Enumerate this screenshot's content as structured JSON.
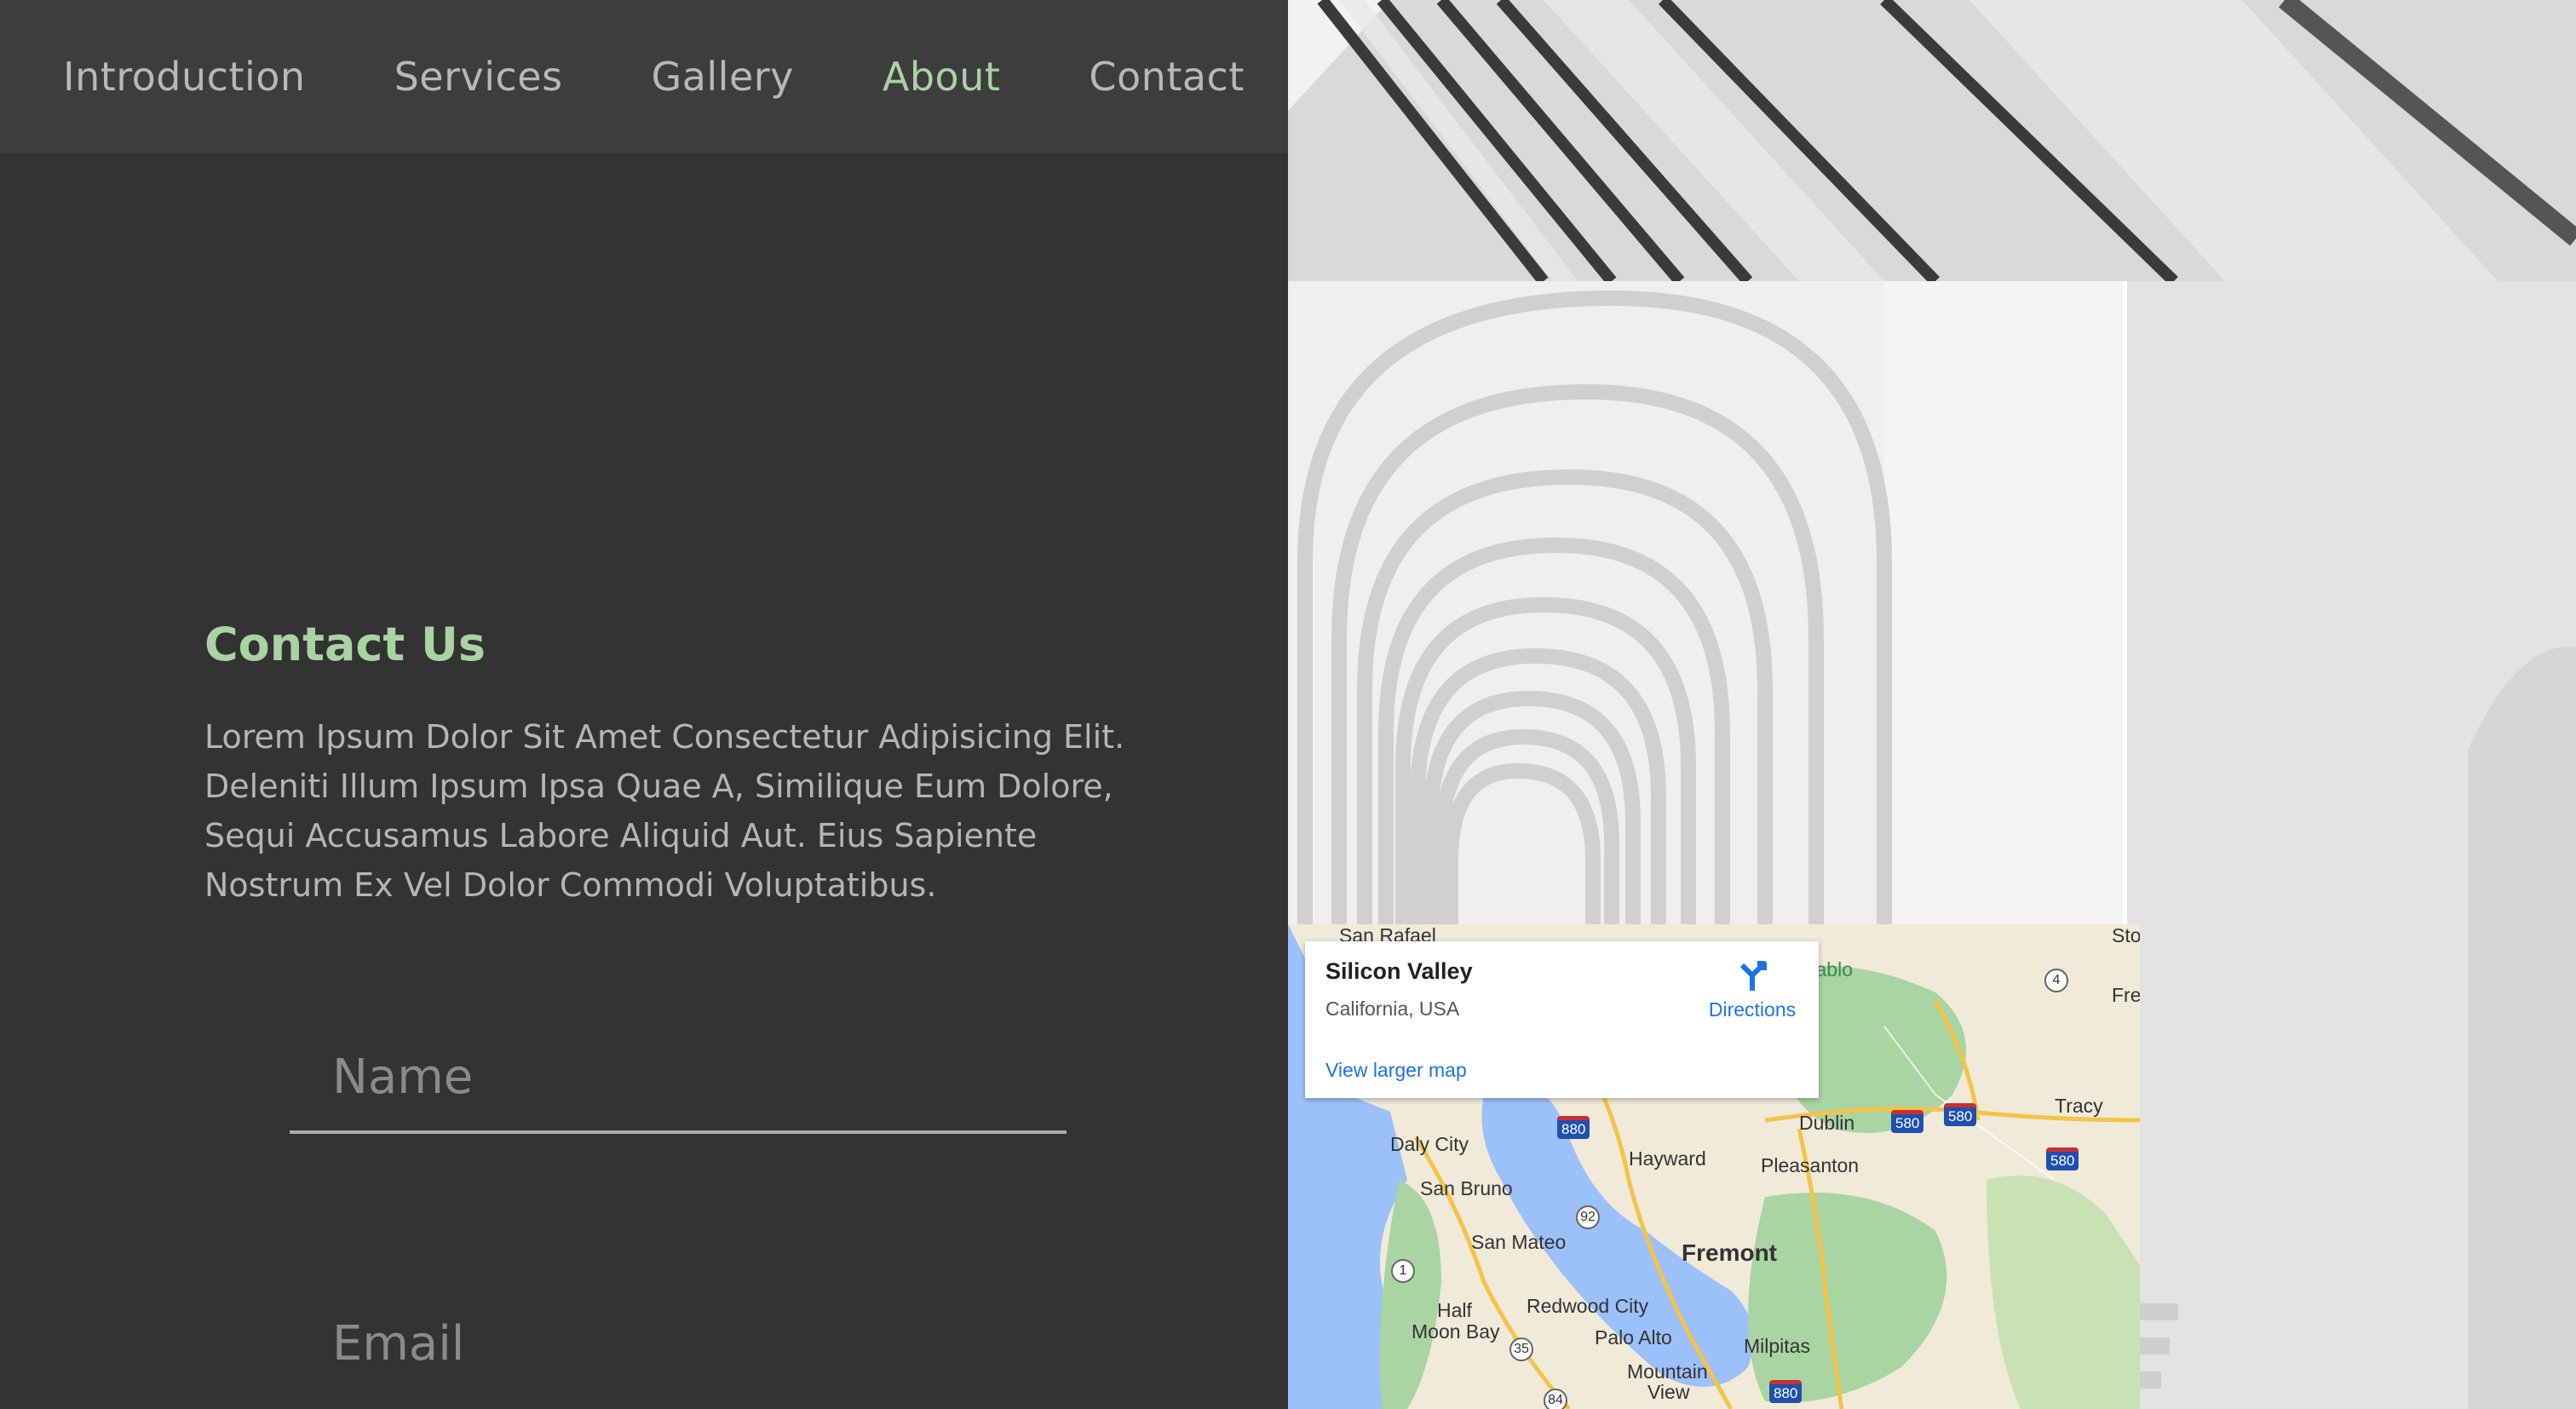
{
  "nav": {
    "items": [
      {
        "label": "Introduction"
      },
      {
        "label": "Services"
      },
      {
        "label": "Gallery"
      },
      {
        "label": "About"
      },
      {
        "label": "Contact"
      }
    ],
    "active": "About"
  },
  "contact": {
    "title": "Contact Us",
    "text": "Lorem Ipsum Dolor Sit Amet Consectetur Adipisicing Elit. Deleniti Illum Ipsum Ipsa Quae A, Similique Eum Dolore, Sequi Accusamus Labore Aliquid Aut. Eius Sapiente Nostrum Ex Vel Dolor Commodi Voluptatibus.",
    "name_placeholder": "Name",
    "email_placeholder": "Email"
  },
  "map": {
    "place": "Silicon Valley",
    "region": "California, USA",
    "directions_label": "Directions",
    "larger_map_label": "View larger map",
    "labels": {
      "san_rafael": "San Rafael",
      "mount_diablo": "t Diablo",
      "stockton": "Sto",
      "fremont_cut": "Fre",
      "tracy": "Tracy",
      "dublin": "Dublin",
      "hayward": "Hayward",
      "pleasanton": "Pleasanton",
      "daly_city": "Daly City",
      "san_bruno": "San Bruno",
      "san_mateo": "San Mateo",
      "fremont": "Fremont",
      "half_moon_bay_1": "Half",
      "half_moon_bay_2": "Moon Bay",
      "redwood_city": "Redwood City",
      "palo_alto": "Palo Alto",
      "milpitas": "Milpitas",
      "mountain_view_1": "Mountain",
      "mountain_view_2": "View"
    },
    "routes": {
      "i880a": "880",
      "i880b": "880",
      "i580a": "580",
      "i580b": "580",
      "i580c": "580",
      "r92": "92",
      "r1": "1",
      "r35": "35",
      "r84": "84",
      "r4": "4"
    }
  },
  "colors": {
    "background": "#333333",
    "navbar": "#3d3d3d",
    "accent": "#a9d3a2",
    "text": "#b5b5b5"
  }
}
